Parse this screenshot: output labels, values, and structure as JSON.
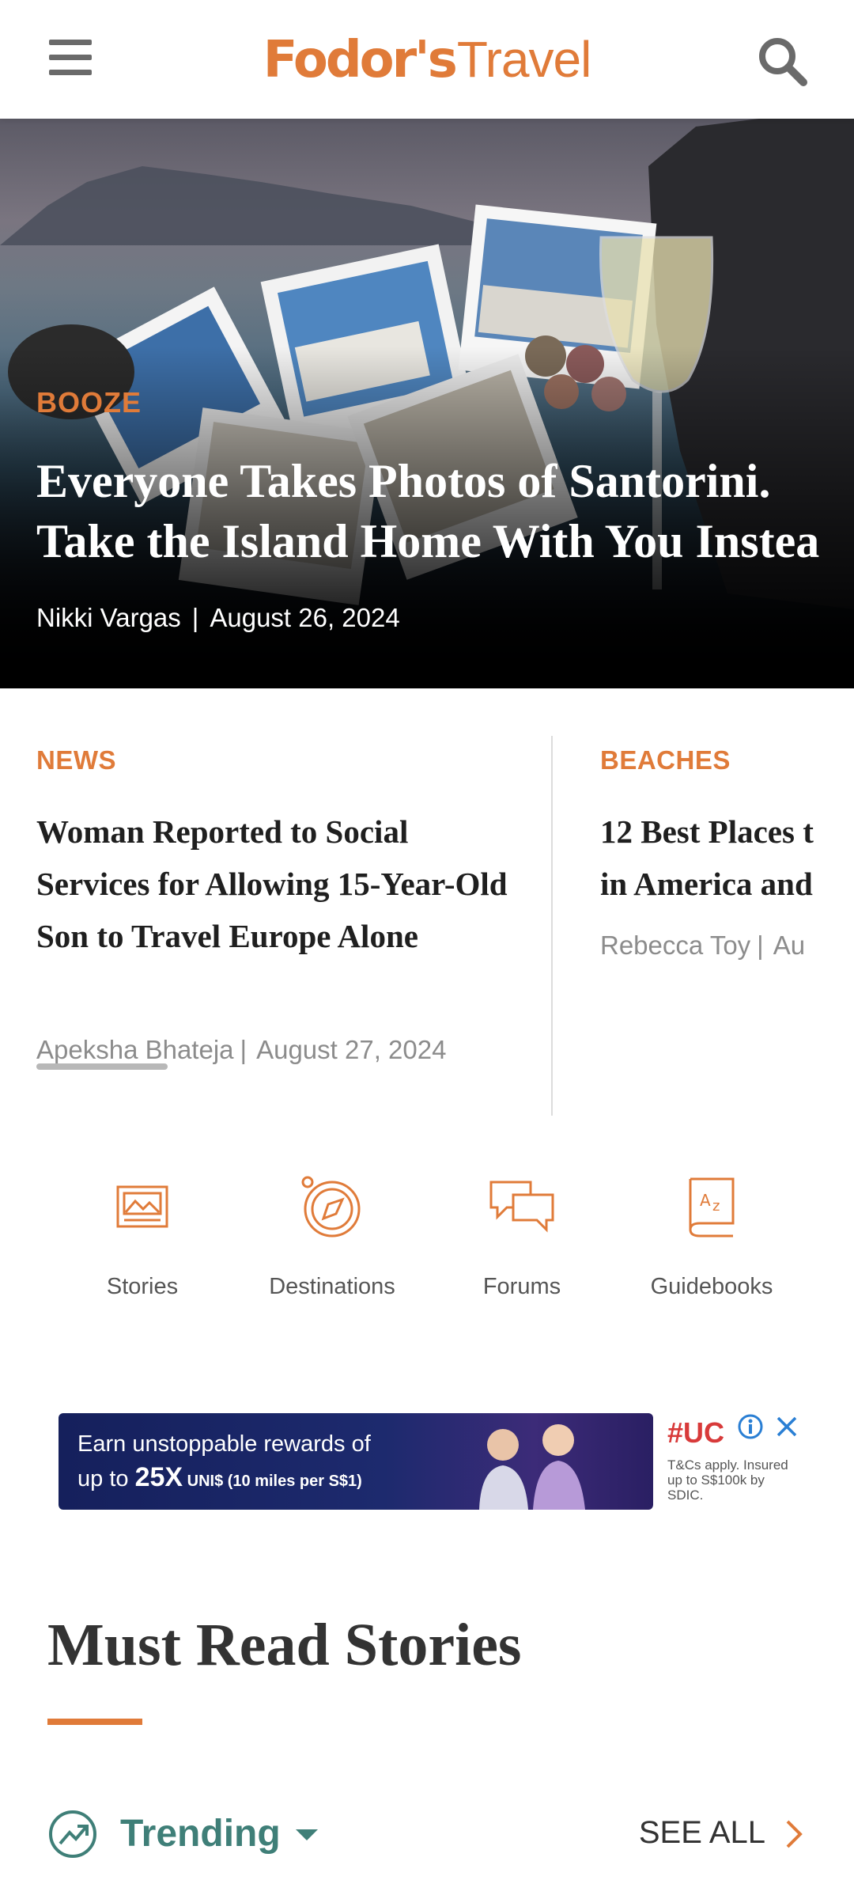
{
  "header": {
    "logo_part1": "Fodor's",
    "logo_part2": "Travel",
    "brand_color": "#e07b39"
  },
  "hero": {
    "category": "BOOZE",
    "title_line1": "Everyone Takes Photos of Santorini.",
    "title_line2": "Take the Island Home With You Instea",
    "author": "Nikki Vargas",
    "separator": "|",
    "date": "August 26, 2024"
  },
  "cards": [
    {
      "category": "NEWS",
      "title": "Woman Reported to Social Services for Allowing 15-Year-Old Son to Travel Europe Alone",
      "author": "Apeksha Bhateja",
      "separator": "|",
      "date": "August 27, 2024"
    },
    {
      "category": "BEACHES",
      "title_line1": "12 Best Places t",
      "title_line2": "in America and",
      "author": "Rebecca Toy",
      "separator": "|",
      "date": "Au"
    }
  ],
  "quick_nav": [
    {
      "label": "Stories",
      "icon": "stories-icon"
    },
    {
      "label": "Destinations",
      "icon": "compass-icon"
    },
    {
      "label": "Forums",
      "icon": "forums-icon"
    },
    {
      "label": "Guidebooks",
      "icon": "guidebook-icon"
    }
  ],
  "ad": {
    "line1": "Earn unstoppable rewards of",
    "line2_prefix": "up to ",
    "line2_big": "25X",
    "line2_small": " UNI$ (10 miles per S$1)",
    "brand": "UC",
    "terms": "T&Cs apply. Insured up to S$100k by SDIC."
  },
  "must_read": {
    "title": "Must Read Stories",
    "filter_label": "Trending",
    "see_all": "SEE ALL",
    "accent_color": "#3f7f78"
  }
}
